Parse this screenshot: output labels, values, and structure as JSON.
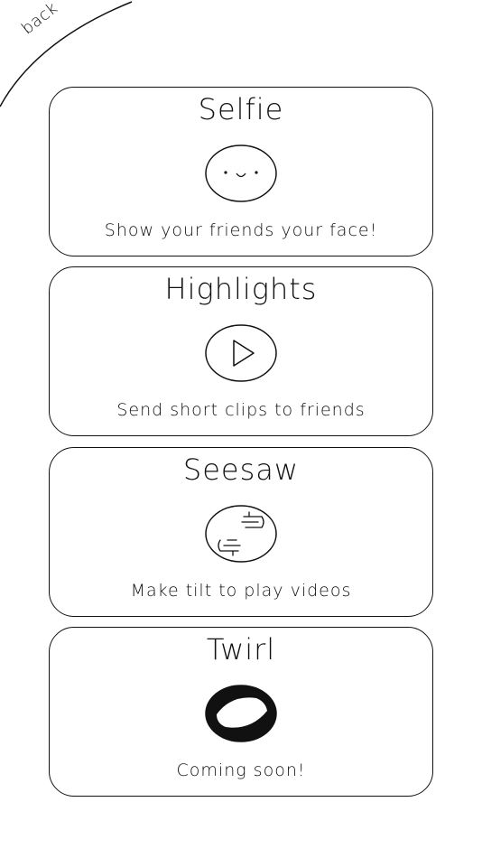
{
  "nav": {
    "back_label": "back"
  },
  "cards": [
    {
      "title": "Selfie",
      "description": "Show your friends your face!",
      "icon": "smiley-face-icon"
    },
    {
      "title": "Highlights",
      "description": "Send short clips to friends",
      "icon": "play-icon"
    },
    {
      "title": "Seesaw",
      "description": "Make tilt to play videos",
      "icon": "hands-frame-icon"
    },
    {
      "title": "Twirl",
      "description": "Coming soon!",
      "icon": "twirl-swirl-icon"
    }
  ],
  "colors": {
    "background": "#ffffff",
    "ink": "#111111"
  }
}
